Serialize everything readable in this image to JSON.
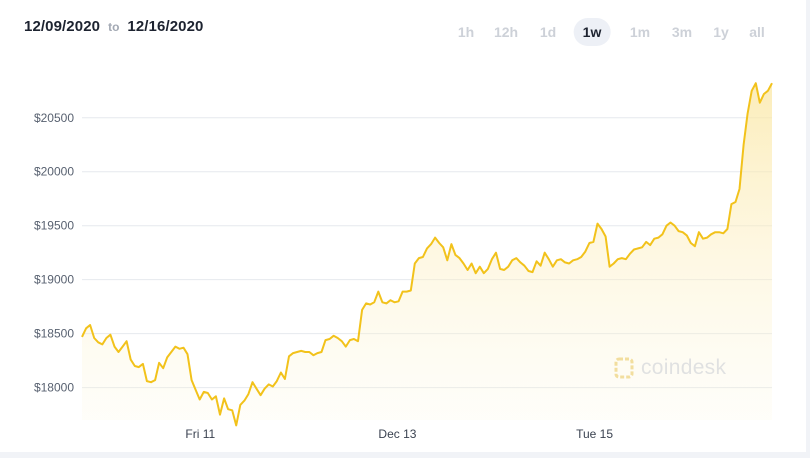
{
  "date_range": {
    "start": "12/09/2020",
    "separator": "to",
    "end": "12/16/2020"
  },
  "range_tabs": [
    {
      "label": "1h",
      "active": false
    },
    {
      "label": "12h",
      "active": false
    },
    {
      "label": "1d",
      "active": false
    },
    {
      "label": "1w",
      "active": true
    },
    {
      "label": "1m",
      "active": false
    },
    {
      "label": "3m",
      "active": false
    },
    {
      "label": "1y",
      "active": false
    },
    {
      "label": "all",
      "active": false
    }
  ],
  "watermark": {
    "text": "coindesk",
    "icon": "coindesk-logo-icon"
  },
  "colors": {
    "line": "#f2c21b",
    "fill_top": "#fbe7a3",
    "tab_active_bg": "#edf0f6",
    "tab_inactive": "#cdd1d8",
    "grid": "#e6e9ee"
  },
  "chart_data": {
    "type": "area",
    "title": "",
    "xlabel": "",
    "ylabel": "",
    "ylim": [
      17700,
      20850
    ],
    "y_ticks": [
      18000,
      18500,
      19000,
      19500,
      20000,
      20500
    ],
    "y_tick_labels": [
      "$18000",
      "$18500",
      "$19000",
      "$19500",
      "$20000",
      "$20500"
    ],
    "x_ticks": [
      {
        "label": "Fri 11",
        "t": 1.2
      },
      {
        "label": "Dec 13",
        "t": 3.2
      },
      {
        "label": "Tue 15",
        "t": 5.2
      }
    ],
    "x_range": [
      0,
      7.0
    ],
    "grid": true,
    "series": [
      {
        "values": [
          18470,
          18550,
          18580,
          18460,
          18420,
          18400,
          18460,
          18490,
          18380,
          18330,
          18380,
          18430,
          18260,
          18200,
          18190,
          18220,
          18060,
          18050,
          18070,
          18230,
          18180,
          18280,
          18330,
          18380,
          18360,
          18370,
          18310,
          18070,
          17980,
          17890,
          17960,
          17950,
          17890,
          17920,
          17750,
          17900,
          17800,
          17790,
          17650,
          17840,
          17880,
          17940,
          18050,
          17990,
          17930,
          17990,
          18030,
          18010,
          18060,
          18140,
          18080,
          18290,
          18320,
          18330,
          18340,
          18330,
          18330,
          18300,
          18320,
          18330,
          18440,
          18450,
          18480,
          18460,
          18430,
          18380,
          18440,
          18450,
          18430,
          18720,
          18780,
          18770,
          18790,
          18890,
          18790,
          18780,
          18810,
          18790,
          18800,
          18890,
          18890,
          18900,
          19150,
          19200,
          19210,
          19290,
          19330,
          19390,
          19340,
          19300,
          19180,
          19330,
          19230,
          19200,
          19150,
          19090,
          19150,
          19060,
          19120,
          19060,
          19100,
          19190,
          19250,
          19100,
          19090,
          19120,
          19180,
          19200,
          19160,
          19130,
          19080,
          19070,
          19170,
          19130,
          19250,
          19190,
          19120,
          19180,
          19190,
          19160,
          19150,
          19180,
          19190,
          19210,
          19260,
          19340,
          19350,
          19520,
          19470,
          19400,
          19120,
          19150,
          19190,
          19200,
          19190,
          19240,
          19280,
          19290,
          19300,
          19350,
          19320,
          19380,
          19390,
          19420,
          19500,
          19530,
          19500,
          19450,
          19440,
          19410,
          19340,
          19310,
          19440,
          19380,
          19390,
          19420,
          19440,
          19440,
          19430,
          19470,
          19700,
          19720,
          19840,
          20250,
          20540,
          20750,
          20820,
          20640,
          20720,
          20750,
          20820
        ]
      }
    ]
  }
}
